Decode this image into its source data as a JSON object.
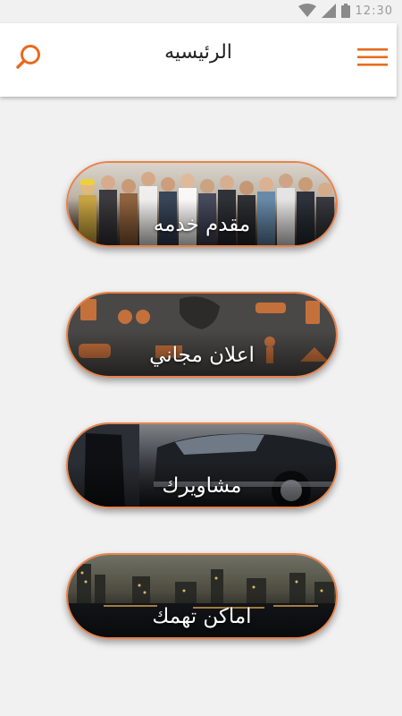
{
  "status_bar": {
    "time": "12:30"
  },
  "header": {
    "title": "الرئيسيه",
    "search_icon": "search-icon",
    "menu_icon": "hamburger-menu-icon"
  },
  "tiles": [
    {
      "label": "مقدم خدمه",
      "image": "workers-group-photo"
    },
    {
      "label": "اعلان مجاني",
      "image": "ads-icons-collage"
    },
    {
      "label": "مشاويرك",
      "image": "car-door-chauffeur"
    },
    {
      "label": "اماكن تهمك",
      "image": "city-night-skyline"
    }
  ],
  "colors": {
    "accent": "#e86a1e",
    "tile_border": "#e8824a",
    "background": "#f1f1f1"
  }
}
